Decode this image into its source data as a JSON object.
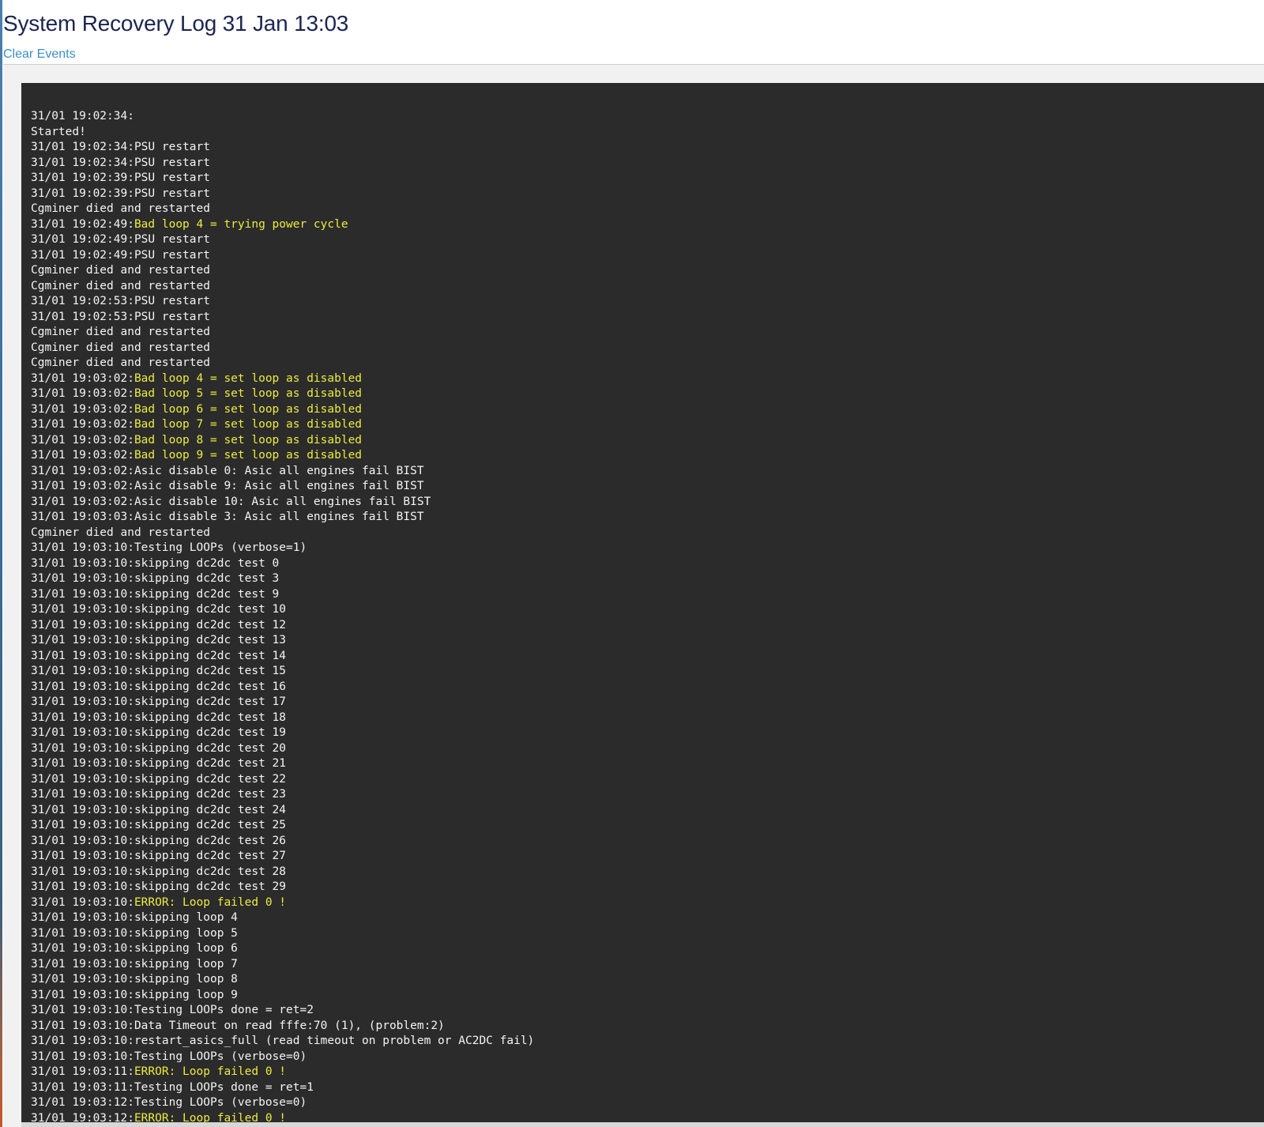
{
  "colors": {
    "title": "#1c2550",
    "link": "#3a8fc7",
    "panel_background": "#2b2b2b",
    "log_text": "#f4f4f4",
    "log_highlight": "#ecec3f"
  },
  "header": {
    "title": "System Recovery Log 31 Jan 13:03",
    "clear_events_label": "Clear Events"
  },
  "log": {
    "lines": [
      {
        "ts": "31/01 19:02:34:",
        "msg": "",
        "level": "normal"
      },
      {
        "ts": "",
        "msg": "Started!",
        "level": "normal"
      },
      {
        "ts": "31/01 19:02:34:",
        "msg": "PSU restart",
        "level": "normal"
      },
      {
        "ts": "31/01 19:02:34:",
        "msg": "PSU restart",
        "level": "normal"
      },
      {
        "ts": "31/01 19:02:39:",
        "msg": "PSU restart",
        "level": "normal"
      },
      {
        "ts": "31/01 19:02:39:",
        "msg": "PSU restart",
        "level": "normal"
      },
      {
        "ts": "",
        "msg": "Cgminer died and restarted",
        "level": "normal"
      },
      {
        "ts": "31/01 19:02:49:",
        "msg": "Bad loop 4 = trying power cycle",
        "level": "warn"
      },
      {
        "ts": "31/01 19:02:49:",
        "msg": "PSU restart",
        "level": "normal"
      },
      {
        "ts": "31/01 19:02:49:",
        "msg": "PSU restart",
        "level": "normal"
      },
      {
        "ts": "",
        "msg": "Cgminer died and restarted",
        "level": "normal"
      },
      {
        "ts": "",
        "msg": "Cgminer died and restarted",
        "level": "normal"
      },
      {
        "ts": "31/01 19:02:53:",
        "msg": "PSU restart",
        "level": "normal"
      },
      {
        "ts": "31/01 19:02:53:",
        "msg": "PSU restart",
        "level": "normal"
      },
      {
        "ts": "",
        "msg": "Cgminer died and restarted",
        "level": "normal"
      },
      {
        "ts": "",
        "msg": "Cgminer died and restarted",
        "level": "normal"
      },
      {
        "ts": "",
        "msg": "Cgminer died and restarted",
        "level": "normal"
      },
      {
        "ts": "31/01 19:03:02:",
        "msg": "Bad loop 4 = set loop as disabled",
        "level": "warn"
      },
      {
        "ts": "31/01 19:03:02:",
        "msg": "Bad loop 5 = set loop as disabled",
        "level": "warn"
      },
      {
        "ts": "31/01 19:03:02:",
        "msg": "Bad loop 6 = set loop as disabled",
        "level": "warn"
      },
      {
        "ts": "31/01 19:03:02:",
        "msg": "Bad loop 7 = set loop as disabled",
        "level": "warn"
      },
      {
        "ts": "31/01 19:03:02:",
        "msg": "Bad loop 8 = set loop as disabled",
        "level": "warn"
      },
      {
        "ts": "31/01 19:03:02:",
        "msg": "Bad loop 9 = set loop as disabled",
        "level": "warn"
      },
      {
        "ts": "31/01 19:03:02:",
        "msg": "Asic disable 0: Asic all engines fail BIST",
        "level": "normal"
      },
      {
        "ts": "31/01 19:03:02:",
        "msg": "Asic disable 9: Asic all engines fail BIST",
        "level": "normal"
      },
      {
        "ts": "31/01 19:03:02:",
        "msg": "Asic disable 10: Asic all engines fail BIST",
        "level": "normal"
      },
      {
        "ts": "31/01 19:03:03:",
        "msg": "Asic disable 3: Asic all engines fail BIST",
        "level": "normal"
      },
      {
        "ts": "",
        "msg": "Cgminer died and restarted",
        "level": "normal"
      },
      {
        "ts": "31/01 19:03:10:",
        "msg": "Testing LOOPs (verbose=1)",
        "level": "normal"
      },
      {
        "ts": "31/01 19:03:10:",
        "msg": "skipping dc2dc test 0",
        "level": "normal"
      },
      {
        "ts": "31/01 19:03:10:",
        "msg": "skipping dc2dc test 3",
        "level": "normal"
      },
      {
        "ts": "31/01 19:03:10:",
        "msg": "skipping dc2dc test 9",
        "level": "normal"
      },
      {
        "ts": "31/01 19:03:10:",
        "msg": "skipping dc2dc test 10",
        "level": "normal"
      },
      {
        "ts": "31/01 19:03:10:",
        "msg": "skipping dc2dc test 12",
        "level": "normal"
      },
      {
        "ts": "31/01 19:03:10:",
        "msg": "skipping dc2dc test 13",
        "level": "normal"
      },
      {
        "ts": "31/01 19:03:10:",
        "msg": "skipping dc2dc test 14",
        "level": "normal"
      },
      {
        "ts": "31/01 19:03:10:",
        "msg": "skipping dc2dc test 15",
        "level": "normal"
      },
      {
        "ts": "31/01 19:03:10:",
        "msg": "skipping dc2dc test 16",
        "level": "normal"
      },
      {
        "ts": "31/01 19:03:10:",
        "msg": "skipping dc2dc test 17",
        "level": "normal"
      },
      {
        "ts": "31/01 19:03:10:",
        "msg": "skipping dc2dc test 18",
        "level": "normal"
      },
      {
        "ts": "31/01 19:03:10:",
        "msg": "skipping dc2dc test 19",
        "level": "normal"
      },
      {
        "ts": "31/01 19:03:10:",
        "msg": "skipping dc2dc test 20",
        "level": "normal"
      },
      {
        "ts": "31/01 19:03:10:",
        "msg": "skipping dc2dc test 21",
        "level": "normal"
      },
      {
        "ts": "31/01 19:03:10:",
        "msg": "skipping dc2dc test 22",
        "level": "normal"
      },
      {
        "ts": "31/01 19:03:10:",
        "msg": "skipping dc2dc test 23",
        "level": "normal"
      },
      {
        "ts": "31/01 19:03:10:",
        "msg": "skipping dc2dc test 24",
        "level": "normal"
      },
      {
        "ts": "31/01 19:03:10:",
        "msg": "skipping dc2dc test 25",
        "level": "normal"
      },
      {
        "ts": "31/01 19:03:10:",
        "msg": "skipping dc2dc test 26",
        "level": "normal"
      },
      {
        "ts": "31/01 19:03:10:",
        "msg": "skipping dc2dc test 27",
        "level": "normal"
      },
      {
        "ts": "31/01 19:03:10:",
        "msg": "skipping dc2dc test 28",
        "level": "normal"
      },
      {
        "ts": "31/01 19:03:10:",
        "msg": "skipping dc2dc test 29",
        "level": "normal"
      },
      {
        "ts": "31/01 19:03:10:",
        "msg": "ERROR: Loop failed 0 !",
        "level": "warn"
      },
      {
        "ts": "31/01 19:03:10:",
        "msg": "skipping loop 4",
        "level": "normal"
      },
      {
        "ts": "31/01 19:03:10:",
        "msg": "skipping loop 5",
        "level": "normal"
      },
      {
        "ts": "31/01 19:03:10:",
        "msg": "skipping loop 6",
        "level": "normal"
      },
      {
        "ts": "31/01 19:03:10:",
        "msg": "skipping loop 7",
        "level": "normal"
      },
      {
        "ts": "31/01 19:03:10:",
        "msg": "skipping loop 8",
        "level": "normal"
      },
      {
        "ts": "31/01 19:03:10:",
        "msg": "skipping loop 9",
        "level": "normal"
      },
      {
        "ts": "31/01 19:03:10:",
        "msg": "Testing LOOPs done = ret=2",
        "level": "normal"
      },
      {
        "ts": "31/01 19:03:10:",
        "msg": "Data Timeout on read fffe:70 (1), (problem:2)",
        "level": "normal"
      },
      {
        "ts": "31/01 19:03:10:",
        "msg": "restart_asics_full (read timeout on problem or AC2DC fail)",
        "level": "normal"
      },
      {
        "ts": "31/01 19:03:10:",
        "msg": "Testing LOOPs (verbose=0)",
        "level": "normal"
      },
      {
        "ts": "31/01 19:03:11:",
        "msg": "ERROR: Loop failed 0 !",
        "level": "warn"
      },
      {
        "ts": "31/01 19:03:11:",
        "msg": "Testing LOOPs done = ret=1",
        "level": "normal"
      },
      {
        "ts": "31/01 19:03:12:",
        "msg": "Testing LOOPs (verbose=0)",
        "level": "normal"
      },
      {
        "ts": "31/01 19:03:12:",
        "msg": "ERROR: Loop failed 0 !",
        "level": "warn"
      }
    ]
  }
}
